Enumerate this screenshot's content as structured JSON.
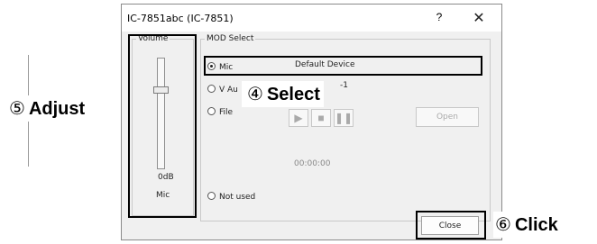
{
  "window": {
    "title": "IC-7851abc (IC-7851)",
    "help_label": "?",
    "close_glyph": "✕"
  },
  "volume": {
    "group_label": "Volume",
    "level_label": "0dB",
    "source_label": "Mic",
    "slider_level": "0dB"
  },
  "mod_select": {
    "group_label": "MOD Select",
    "options": [
      {
        "label": "Mic",
        "selected": true
      },
      {
        "label": "V Au",
        "selected": false
      },
      {
        "label": "File",
        "selected": false
      },
      {
        "label": "Not used",
        "selected": false
      }
    ],
    "device_name": "Default Device",
    "v_suffix": "-1",
    "playback": {
      "play_icon": "play-icon",
      "stop_icon": "stop-icon",
      "pause_icon": "pause-icon",
      "open_label": "Open",
      "time": "00:00:00"
    }
  },
  "footer": {
    "close_label": "Close"
  },
  "annotations": {
    "adjust": {
      "num": "⑤",
      "text": "Adjust"
    },
    "select": {
      "num": "④",
      "text": "Select"
    },
    "click": {
      "num": "⑥",
      "text": "Click"
    }
  },
  "colors": {
    "dialog_bg": "#f0f0f0",
    "highlight": "#000000",
    "disabled_text": "#aaaaaa"
  }
}
